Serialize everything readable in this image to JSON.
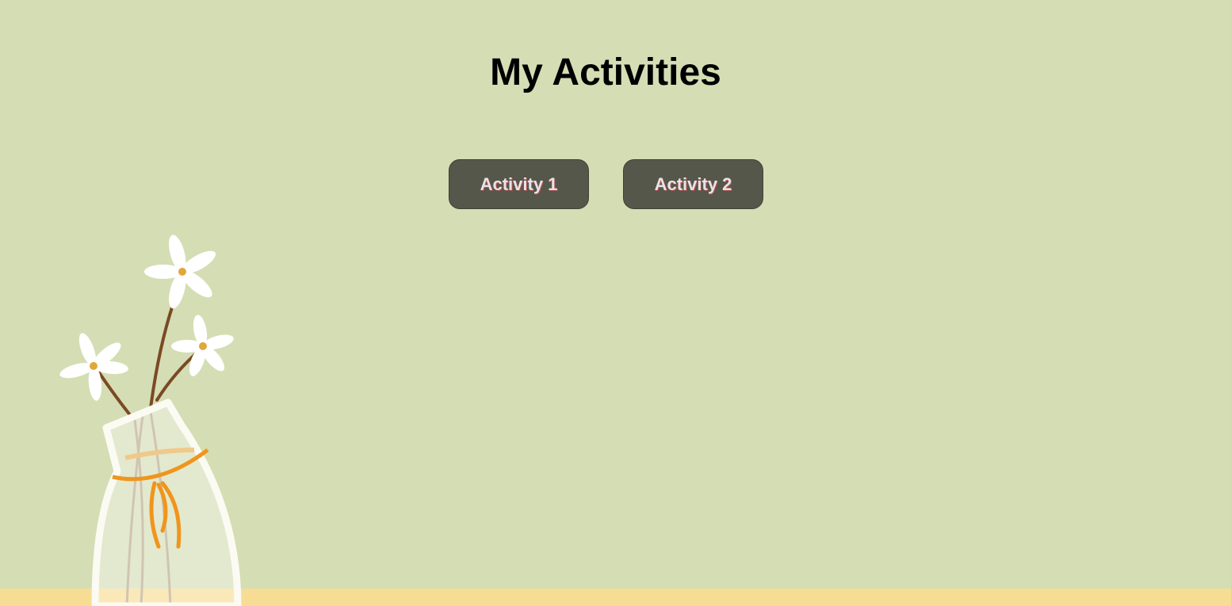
{
  "page": {
    "title": "My Activities"
  },
  "buttons": [
    {
      "label": "Activity 1"
    },
    {
      "label": "Activity 2"
    }
  ],
  "colors": {
    "background": "#d5ddb4",
    "button": "#55574a",
    "floor": "#f7dc94"
  }
}
